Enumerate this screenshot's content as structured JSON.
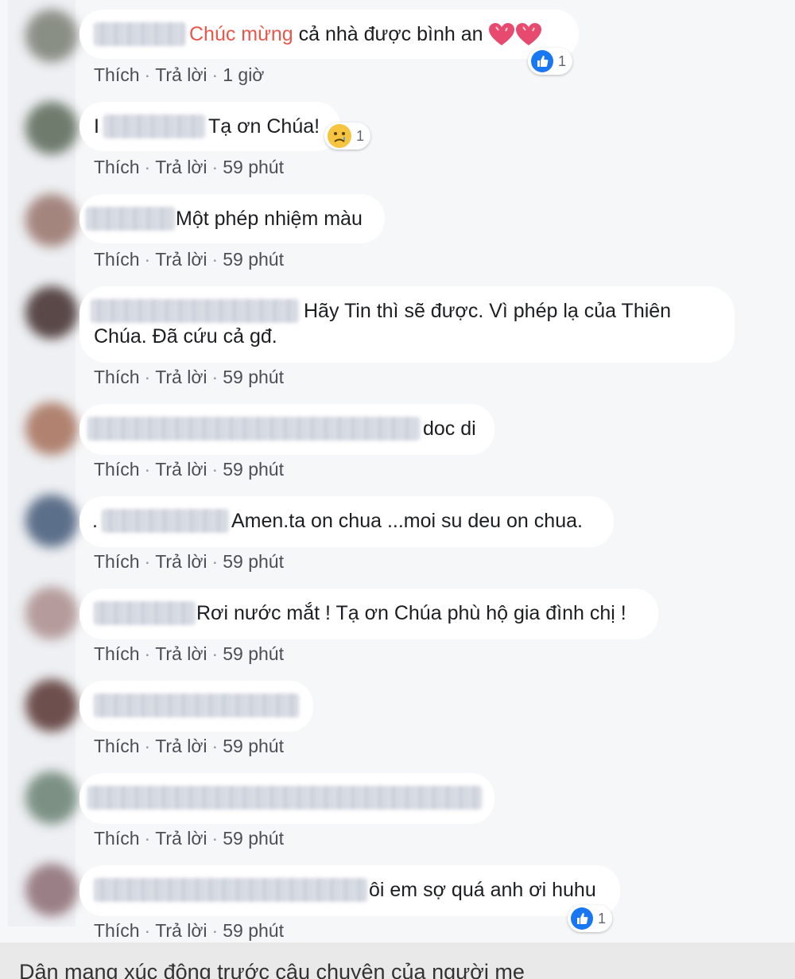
{
  "comments": [
    {
      "prefix": "",
      "highlight": "Chúc mừng",
      "text": " cả nhà được bình an",
      "action_like": "Thích",
      "action_reply": "Trả lời",
      "time": "1 giờ",
      "reaction_count": "1"
    },
    {
      "prefix": "I",
      "highlight": "",
      "text": "Tạ ơn Chúa!",
      "action_like": "Thích",
      "action_reply": "Trả lời",
      "time": "59 phút",
      "reaction_count": "1"
    },
    {
      "prefix": "",
      "highlight": "",
      "text": "Một phép nhiệm màu",
      "action_like": "Thích",
      "action_reply": "Trả lời",
      "time": "59 phút"
    },
    {
      "prefix": "",
      "highlight": "",
      "text": "Hãy Tin thì sẽ được. Vì phép lạ của Thiên",
      "text_line2": "Chúa. Đã cứu cả gđ.",
      "action_like": "Thích",
      "action_reply": "Trả lời",
      "time": "59 phút"
    },
    {
      "prefix": "",
      "highlight": "",
      "text": "doc di",
      "action_like": "Thích",
      "action_reply": "Trả lời",
      "time": "59 phút"
    },
    {
      "prefix": ".",
      "highlight": "",
      "text": "Amen.ta on chua ...moi su deu on chua.",
      "action_like": "Thích",
      "action_reply": "Trả lời",
      "time": "59 phút"
    },
    {
      "prefix": "",
      "highlight": "",
      "text": "Rơi nước mắt ! Tạ ơn Chúa phù hộ gia đình chị !",
      "action_like": "Thích",
      "action_reply": "Trả lời",
      "time": "59 phút"
    },
    {
      "prefix": "",
      "highlight": "",
      "text": "",
      "action_like": "Thích",
      "action_reply": "Trả lời",
      "time": "59 phút"
    },
    {
      "prefix": "",
      "highlight": "",
      "text": "",
      "action_like": "Thích",
      "action_reply": "Trả lời",
      "time": "59 phút"
    },
    {
      "prefix": "",
      "highlight": "",
      "text": "ôi em sợ quá anh ơi huhu",
      "action_like": "Thích",
      "action_reply": "Trả lời",
      "time": "59 phút",
      "reaction_count": "1"
    }
  ],
  "caption": "Dân mạng xúc động trước câu chuyện của người mẹ",
  "icons": {
    "like": "like-icon",
    "sad": "sad-icon",
    "heart": "heart-icon"
  },
  "colors": {
    "highlight": "#e9574b",
    "like_blue": "#1877f2",
    "bubble": "#ffffff",
    "background": "#f6f7f9"
  }
}
